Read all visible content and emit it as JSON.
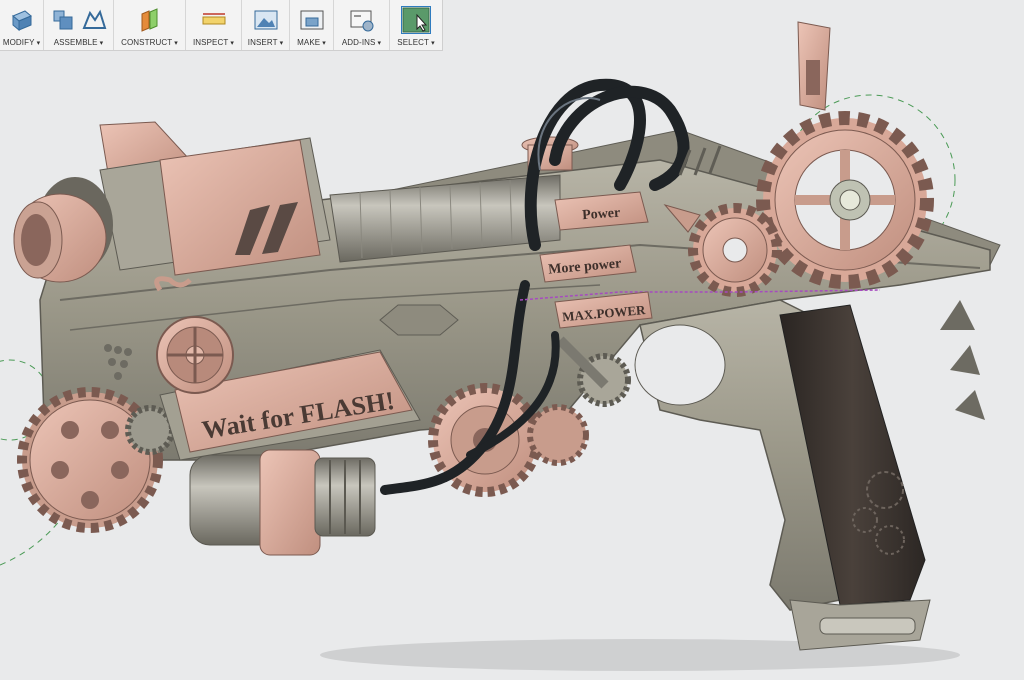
{
  "toolbar": {
    "modify": "MODIFY",
    "assemble": "ASSEMBLE",
    "construct": "CONSTRUCT",
    "inspect": "INSPECT",
    "insert": "INSERT",
    "make": "MAKE",
    "addins": "ADD-INS",
    "select": "SELECT"
  },
  "model": {
    "plate_power": "Power",
    "plate_more_power": "More power",
    "plate_max_power": "MAX.POWER",
    "banner_text": "Wait for FLASH!"
  },
  "colors": {
    "body_gray": "#9a9788",
    "copper": "#d8a898",
    "dark_grip": "#3b3430",
    "background": "#e9eaeb"
  }
}
